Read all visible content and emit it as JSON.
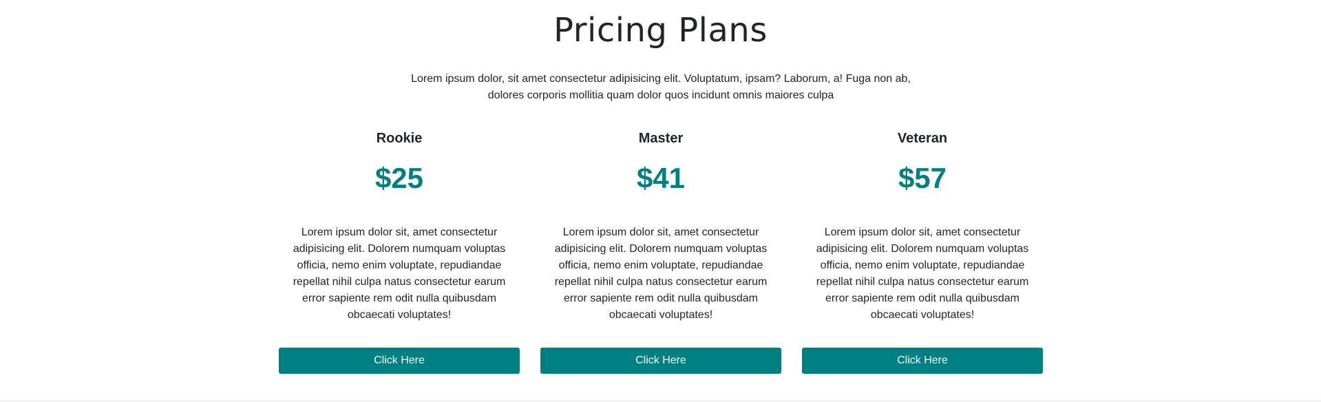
{
  "section": {
    "title": "Pricing Plans",
    "intro": "Lorem ipsum dolor, sit amet consectetur adipisicing elit. Voluptatum, ipsam? Laborum, a! Fuga non ab, dolores corporis mollitia quam dolor quos incidunt omnis maiores culpa"
  },
  "plans": [
    {
      "name": "Rookie",
      "price": "$25",
      "description": "Lorem ipsum dolor sit, amet consectetur adipisicing elit. Dolorem numquam voluptas officia, nemo enim voluptate, repudiandae repellat nihil culpa natus consectetur earum error sapiente rem odit nulla quibusdam obcaecati voluptates!",
      "button_label": "Click Here"
    },
    {
      "name": "Master",
      "price": "$41",
      "description": "Lorem ipsum dolor sit, amet consectetur adipisicing elit. Dolorem numquam voluptas officia, nemo enim voluptate, repudiandae repellat nihil culpa natus consectetur earum error sapiente rem odit nulla quibusdam obcaecati voluptates!",
      "button_label": "Click Here"
    },
    {
      "name": "Veteran",
      "price": "$57",
      "description": "Lorem ipsum dolor sit, amet consectetur adipisicing elit. Dolorem numquam voluptas officia, nemo enim voluptate, repudiandae repellat nihil culpa natus consectetur earum error sapiente rem odit nulla quibusdam obcaecati voluptates!",
      "button_label": "Click Here"
    }
  ],
  "colors": {
    "accent": "#008080",
    "text": "#212529",
    "background": "#ffffff"
  }
}
